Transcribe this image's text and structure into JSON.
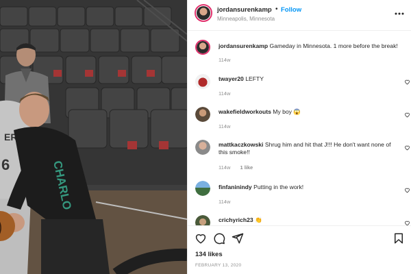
{
  "header": {
    "username": "jordansurenkamp",
    "dot": "•",
    "follow_label": "Follow",
    "location": "Minneapolis, Minnesota"
  },
  "caption": {
    "username": "jordansurenkamp",
    "text": "Gameday in Minnesota. 1 more before the break!",
    "time": "114w"
  },
  "comments": [
    {
      "username": "twayer20",
      "text": "LEFTY",
      "time": "114w",
      "likes": ""
    },
    {
      "username": "wakefieldworkouts",
      "text": "My boy 😱",
      "time": "114w",
      "likes": ""
    },
    {
      "username": "mattkaczkowski",
      "text": "Shrug him and hit that J!!! He don't want none of this smoke!!",
      "time": "114w",
      "likes": "1 like"
    },
    {
      "username": "finfaninindy",
      "text": "Putting in the work!",
      "time": "114w",
      "likes": ""
    },
    {
      "username": "crichyrich23",
      "text": "👏",
      "time": "",
      "likes": ""
    }
  ],
  "footer": {
    "likes": "134 likes",
    "date": "FEBRUARY 13, 2020"
  },
  "photo": {
    "jersey_text": "ERS",
    "jersey_number": "6",
    "shirt_text": "CHARLO"
  },
  "icons": {
    "more": "more-options-icon",
    "like": "heart-icon",
    "comment": "comment-bubble-icon",
    "share": "send-icon",
    "save": "bookmark-icon",
    "comment_like": "small-heart-icon"
  },
  "colors": {
    "accent_blue": "#0095f6",
    "text": "#262626",
    "muted": "#8e8e8e",
    "story_ring": "#e1306c"
  }
}
